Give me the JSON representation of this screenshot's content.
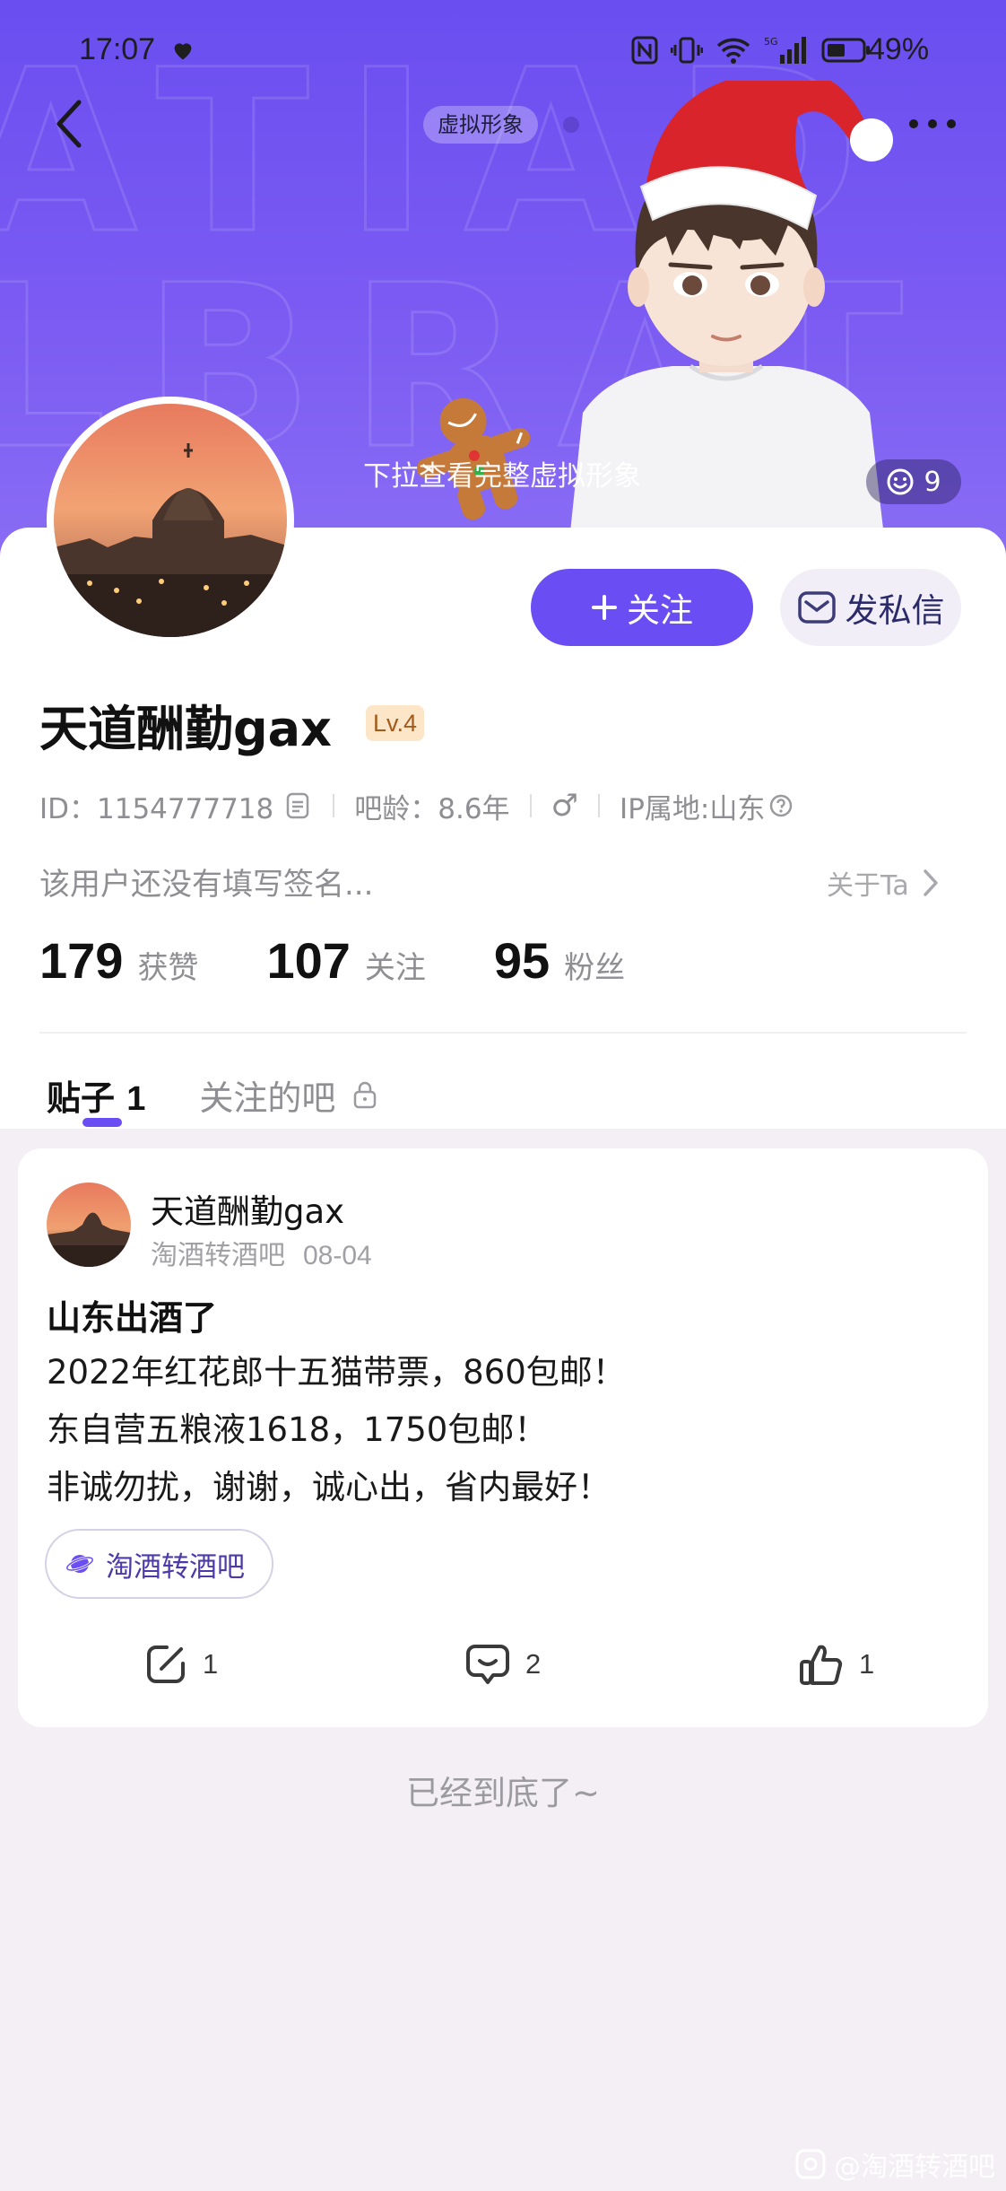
{
  "status_bar": {
    "time": "17:07",
    "battery": "49%"
  },
  "header": {
    "avatar_chip": "虚拟形象",
    "pull_hint": "下拉查看完整虚拟形象",
    "like_count": "9"
  },
  "profile": {
    "follow_button": "关注",
    "message_button": "发私信",
    "username": "天道酬勤gax",
    "level": "Lv.4",
    "id_text": "ID：1154777718",
    "bar_age": "吧龄：8.6年",
    "gender_symbol": "♂",
    "ip_location": "IP属地:山东",
    "signature": "该用户还没有填写签名...",
    "about_link": "关于Ta",
    "stats": [
      {
        "value": "179",
        "label": "获赞"
      },
      {
        "value": "107",
        "label": "关注"
      },
      {
        "value": "95",
        "label": "粉丝"
      }
    ]
  },
  "tabs": {
    "posts_label": "贴子",
    "posts_count": "1",
    "followed_bars": "关注的吧"
  },
  "post": {
    "author": "天道酬勤gax",
    "forum": "淘酒转酒吧",
    "date": "08-04",
    "title": "山东出酒了",
    "lines": [
      "2022年红花郎十五猫带票，860包邮！",
      "东自营五粮液1618，1750包邮！",
      "非诚勿扰，谢谢，诚心出，省内最好！"
    ],
    "tag": "淘酒转酒吧",
    "share_count": "1",
    "comment_count": "2",
    "like_count": "1"
  },
  "footer": {
    "end_text": "已经到底了~",
    "watermark": "@淘酒转酒吧"
  }
}
